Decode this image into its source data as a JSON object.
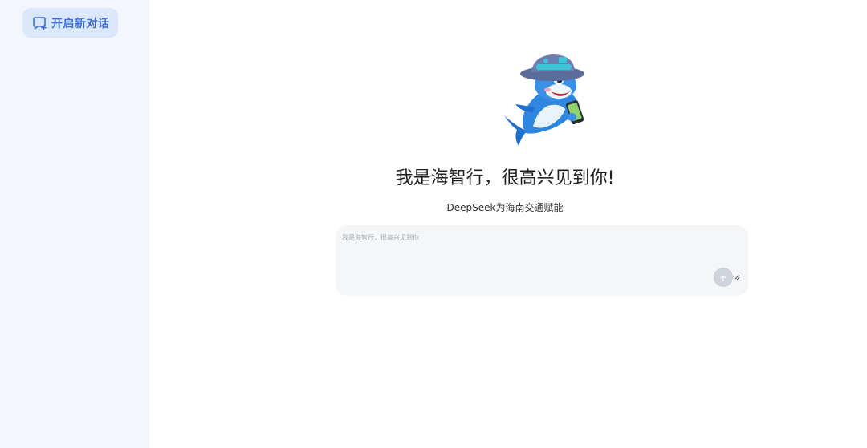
{
  "sidebar": {
    "new_chat_label": "开启新对话",
    "new_chat_icon": "chat-plus-icon"
  },
  "main": {
    "mascot_icon": "dolphin-mascot-icon",
    "greeting": "我是海智行，很高兴见到你!",
    "subtitle": "DeepSeek为海南交通赋能",
    "composer": {
      "placeholder": "我是海智行，很高兴见到你",
      "value": "",
      "send_icon": "arrow-up-icon"
    }
  },
  "colors": {
    "sidebar_bg": "#f3f7fd",
    "button_bg": "#dbe8fb",
    "accent": "#3d6fd6",
    "composer_bg": "#f5f6f8",
    "send_bg": "#cfd3da"
  }
}
